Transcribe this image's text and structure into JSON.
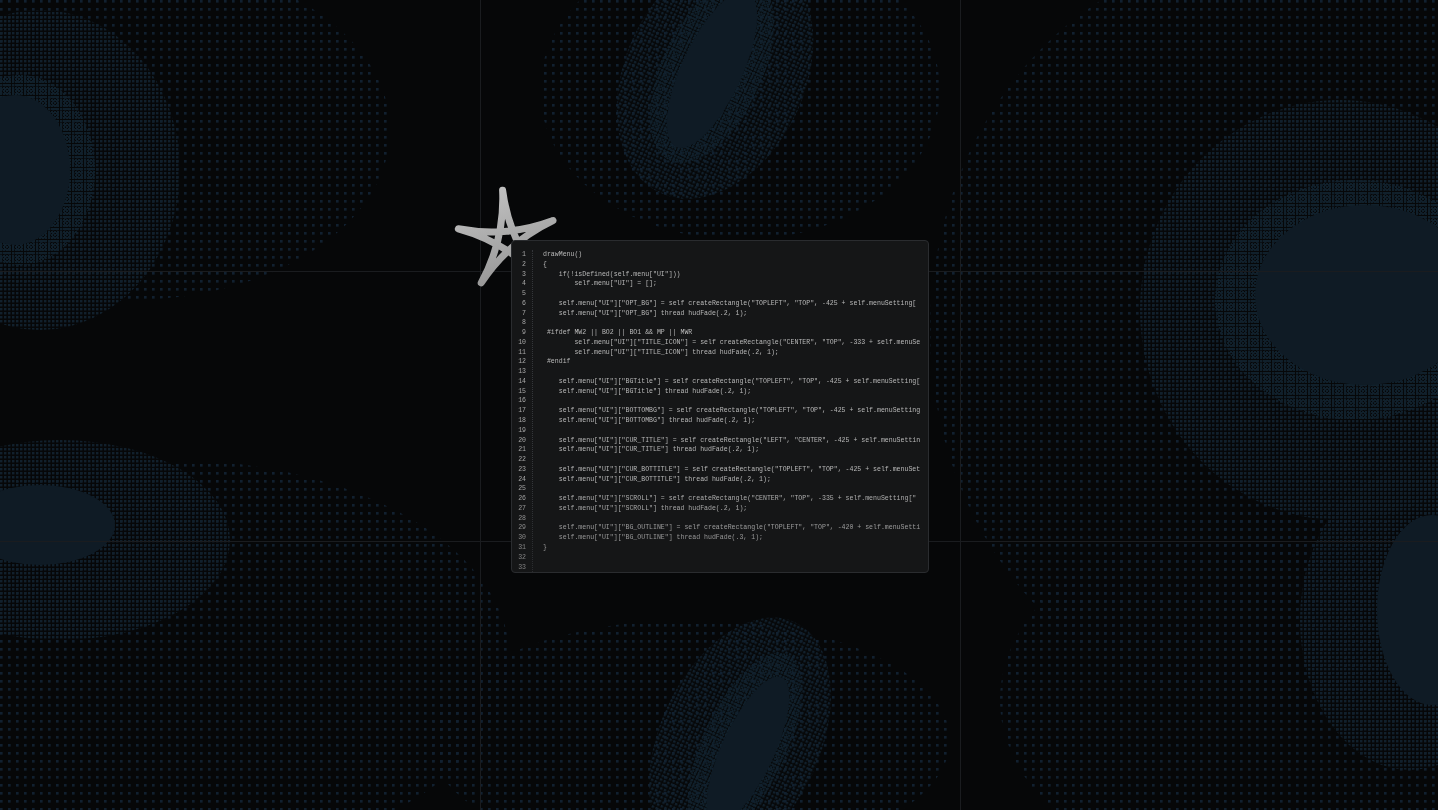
{
  "editor": {
    "lines": [
      {
        "number": "1",
        "code": "drawMenu()"
      },
      {
        "number": "2",
        "code": "{"
      },
      {
        "number": "3",
        "code": "    if(!isDefined(self.menu[\"UI\"]))"
      },
      {
        "number": "4",
        "code": "        self.menu[\"UI\"] = [];"
      },
      {
        "number": "5"
      },
      {
        "number": "6",
        "code": "    self.menu[\"UI\"][\"OPT_BG\"] = self createRectangle(\"TOPLEFT\", \"TOP\", -425 + self.menuSetting["
      },
      {
        "number": "7",
        "code": "    self.menu[\"UI\"][\"OPT_BG\"] thread hudFade(.2, 1);"
      },
      {
        "number": "8"
      },
      {
        "number": "9",
        "code": " #ifdef MW2 || BO2 || BO1 && MP || MWR"
      },
      {
        "number": "10",
        "code": "        self.menu[\"UI\"][\"TITLE_ICON\"] = self createRectangle(\"CENTER\", \"TOP\", -333 + self.menuSe"
      },
      {
        "number": "11",
        "code": "        self.menu[\"UI\"][\"TITLE_ICON\"] thread hudFade(.2, 1);"
      },
      {
        "number": "12",
        "code": " #endif"
      },
      {
        "number": "13"
      },
      {
        "number": "14",
        "code": "    self.menu[\"UI\"][\"BGTitle\"] = self createRectangle(\"TOPLEFT\", \"TOP\", -425 + self.menuSetting["
      },
      {
        "number": "15",
        "code": "    self.menu[\"UI\"][\"BGTitle\"] thread hudFade(.2, 1);"
      },
      {
        "number": "16"
      },
      {
        "number": "17",
        "code": "    self.menu[\"UI\"][\"BOTTOMBG\"] = self createRectangle(\"TOPLEFT\", \"TOP\", -425 + self.menuSetting"
      },
      {
        "number": "18",
        "code": "    self.menu[\"UI\"][\"BOTTOMBG\"] thread hudFade(.2, 1);"
      },
      {
        "number": "19"
      },
      {
        "number": "20",
        "code": "    self.menu[\"UI\"][\"CUR_TITLE\"] = self createRectangle(\"LEFT\", \"CENTER\", -425 + self.menuSettin"
      },
      {
        "number": "21",
        "code": "    self.menu[\"UI\"][\"CUR_TITLE\"] thread hudFade(.2, 1);"
      },
      {
        "number": "22"
      },
      {
        "number": "23",
        "code": "    self.menu[\"UI\"][\"CUR_BOTTITLE\"] = self createRectangle(\"TOPLEFT\", \"TOP\", -425 + self.menuSet"
      },
      {
        "number": "24",
        "code": "    self.menu[\"UI\"][\"CUR_BOTTITLE\"] thread hudFade(.2, 1);"
      },
      {
        "number": "25"
      },
      {
        "number": "26",
        "code": "    self.menu[\"UI\"][\"SCROLL\"] = self createRectangle(\"CENTER\", \"TOP\", -335 + self.menuSetting[\""
      },
      {
        "number": "27",
        "code": "    self.menu[\"UI\"][\"SCROLL\"] thread hudFade(.2, 1);"
      },
      {
        "number": "28"
      },
      {
        "number": "29",
        "code": "    self.menu[\"UI\"][\"BG_OUTLINE\"] = self createRectangle(\"TOPLEFT\", \"TOP\", -420 + self.menuSetti"
      },
      {
        "number": "30",
        "code": "    self.menu[\"UI\"][\"BG_OUTLINE\"] thread hudFade(.3, 1);"
      },
      {
        "number": "31",
        "code": "}"
      },
      {
        "number": "32"
      },
      {
        "number": "33"
      }
    ]
  }
}
